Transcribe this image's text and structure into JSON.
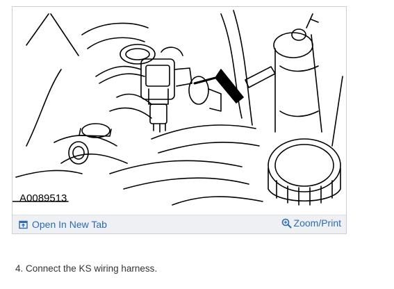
{
  "figure": {
    "id_label": "A0089513",
    "open_tab_label": "Open In New Tab",
    "zoom_print_label": "Zoom/Print",
    "link_color": "#2b6cb0",
    "footer_bg": "#eef0f3"
  },
  "icons": {
    "open_tab": "open-in-new-tab-icon",
    "zoom": "magnifier-zoom-icon"
  },
  "instructions": {
    "step_text": "4. Connect the KS wiring harness."
  }
}
